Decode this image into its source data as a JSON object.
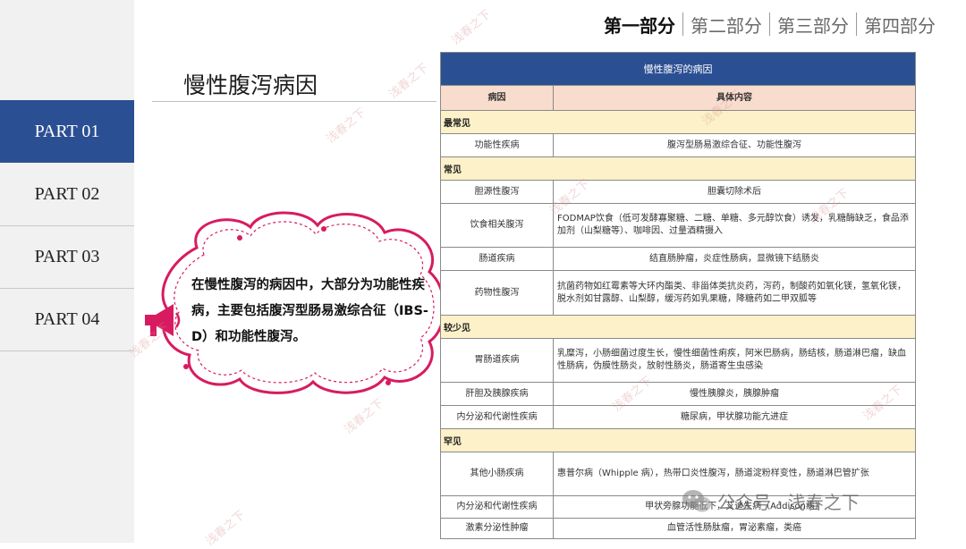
{
  "nav": {
    "items": [
      {
        "label": "第一部分",
        "active": true
      },
      {
        "label": "第二部分",
        "active": false
      },
      {
        "label": "第三部分",
        "active": false
      },
      {
        "label": "第四部分",
        "active": false
      }
    ]
  },
  "sidebar": {
    "parts": [
      {
        "label": "PART 01",
        "active": true
      },
      {
        "label": "PART 02",
        "active": false
      },
      {
        "label": "PART 03",
        "active": false
      },
      {
        "label": "PART 04",
        "active": false
      }
    ]
  },
  "slide_title": "慢性腹泻病因",
  "bubble_text": "在慢性腹泻的病因中，大部分为功能性疾病，主要包括腹泻型肠易激综合征（IBS-D）和功能性腹泻。",
  "table": {
    "title": "慢性腹泻的病因",
    "headers": [
      "病因",
      "具体内容"
    ],
    "sections": [
      {
        "label": "最常见",
        "rows": [
          {
            "cause": "功能性疾病",
            "detail": "腹泻型肠易激综合征、功能性腹泻"
          }
        ]
      },
      {
        "label": "常见",
        "rows": [
          {
            "cause": "胆源性腹泻",
            "detail": "胆囊切除术后"
          },
          {
            "cause": "饮食相关腹泻",
            "detail": "FODMAP饮食（低可发酵寡聚糖、二糖、单糖、多元醇饮食）诱发，乳糖酶缺乏，食品添加剂（山梨糖等）、咖啡因、过量酒精摄入"
          },
          {
            "cause": "肠道疾病",
            "detail": "结直肠肿瘤，炎症性肠病，显微镜下结肠炎"
          },
          {
            "cause": "药物性腹泻",
            "detail": "抗菌药物如红霉素等大环内酯类、非甾体类抗炎药，泻药，制酸药如氧化镁，氢氧化镁，脱水剂如甘露醇、山梨醇，缓泻药如乳果糖，降糖药如二甲双胍等"
          }
        ]
      },
      {
        "label": "较少见",
        "rows": [
          {
            "cause": "胃肠道疾病",
            "detail": "乳糜泻，小肠细菌过度生长，慢性细菌性痢疾，阿米巴肠病，肠结核，肠道淋巴瘤，缺血性肠病，伪膜性肠炎，放射性肠炎，肠道寄生虫感染"
          },
          {
            "cause": "肝胆及胰腺疾病",
            "detail": "慢性胰腺炎，胰腺肿瘤"
          },
          {
            "cause": "内分泌和代谢性疾病",
            "detail": "糖尿病，甲状腺功能亢进症"
          }
        ]
      },
      {
        "label": "罕见",
        "rows": [
          {
            "cause": "其他小肠疾病",
            "detail": "惠普尔病（Whipple 病），热带口炎性腹泻，肠道淀粉样变性，肠道淋巴管扩张"
          },
          {
            "cause": "内分泌和代谢性疾病",
            "detail": "甲状旁腺功能低下，艾迪生病（Addison病）"
          },
          {
            "cause": "激素分泌性肿瘤",
            "detail": "血管活性肠肽瘤，胃泌素瘤，类癌"
          }
        ]
      }
    ]
  },
  "watermark": {
    "text": "浅春之下",
    "account_prefix": "公众号 ·",
    "account_name": "浅春之下"
  },
  "colors": {
    "accent": "#2b4f93",
    "bubble": "#d81b60",
    "header_bg": "#f8dccd",
    "section_bg": "#fcf1c8"
  }
}
